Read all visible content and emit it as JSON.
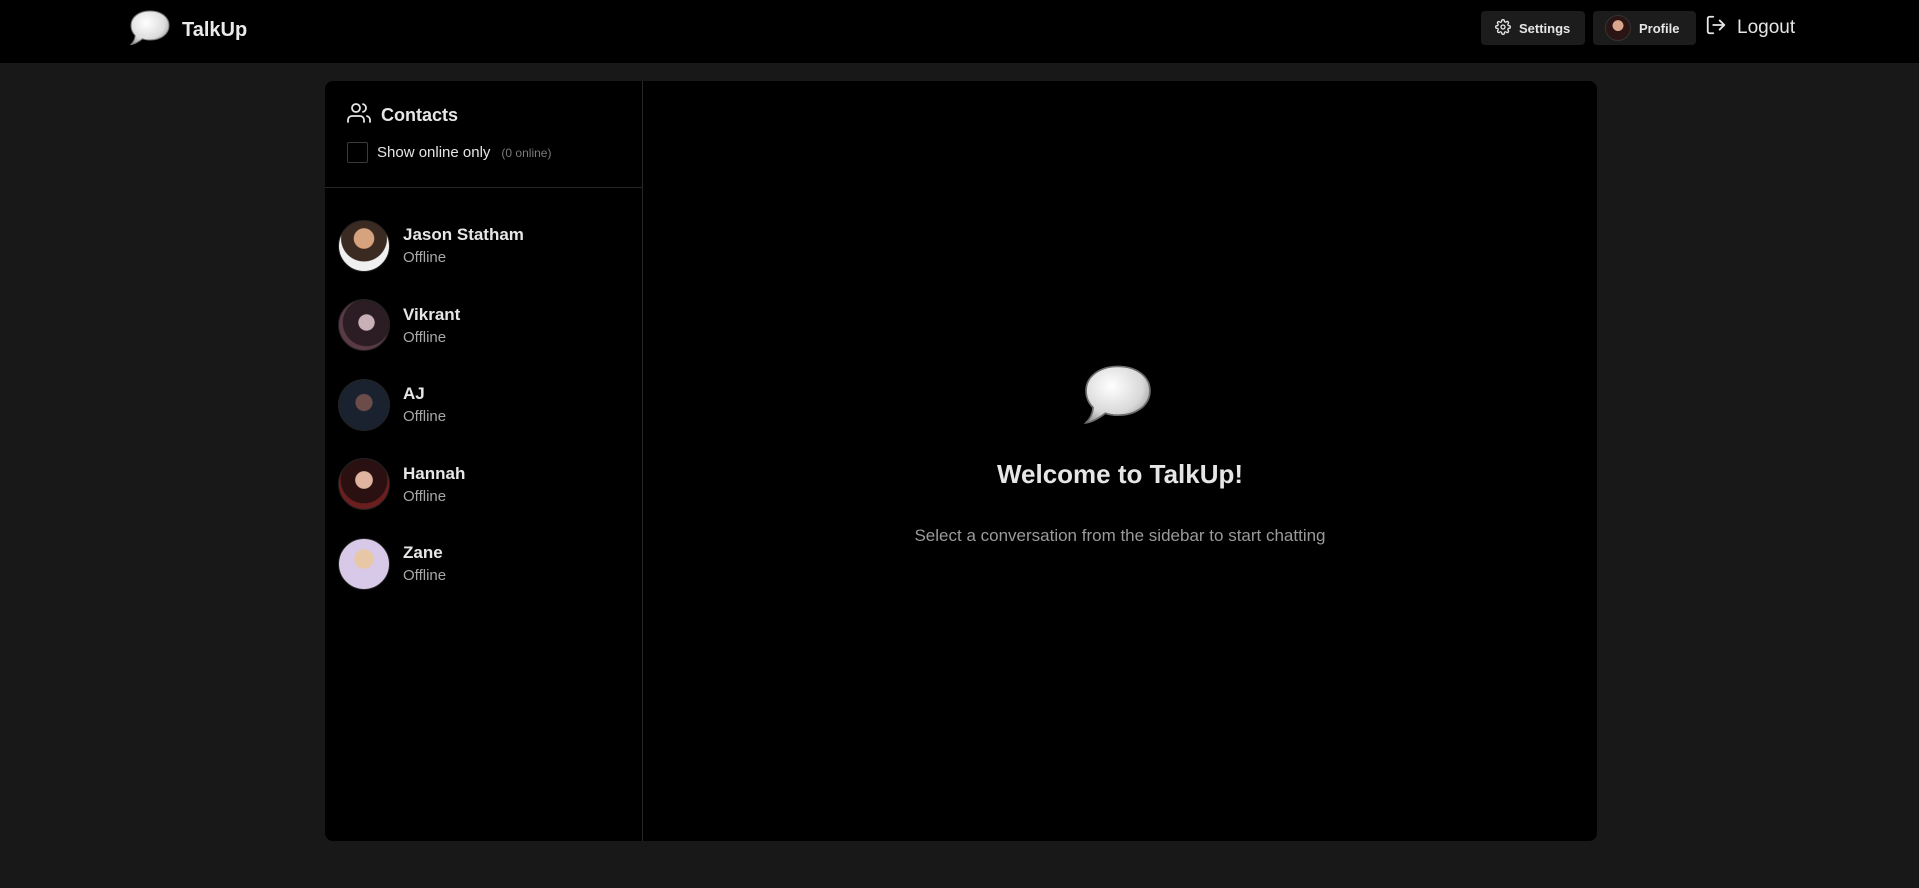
{
  "header": {
    "app_name": "TalkUp",
    "settings_label": "Settings",
    "profile_label": "Profile",
    "logout_label": "Logout"
  },
  "sidebar": {
    "title": "Contacts",
    "online_filter_label": "Show online only",
    "online_count": "(0 online)",
    "online_filter_checked": false,
    "contacts": [
      {
        "name": "Jason Statham",
        "status": "Offline"
      },
      {
        "name": "Vikrant",
        "status": "Offline"
      },
      {
        "name": "AJ",
        "status": "Offline"
      },
      {
        "name": "Hannah",
        "status": "Offline"
      },
      {
        "name": "Zane",
        "status": "Offline"
      }
    ]
  },
  "welcome": {
    "title": "Welcome to TalkUp!",
    "subtitle": "Select a conversation from the sidebar to start chatting"
  },
  "icons": {
    "logo": "speech-bubble-icon",
    "settings": "gear-icon",
    "logout": "logout-icon",
    "contacts": "users-icon"
  },
  "colors": {
    "page_bg": "#181818",
    "topbar_bg": "#000000",
    "card_bg": "#000000",
    "text": "#e6e6e6",
    "muted": "#a8a8a8"
  }
}
